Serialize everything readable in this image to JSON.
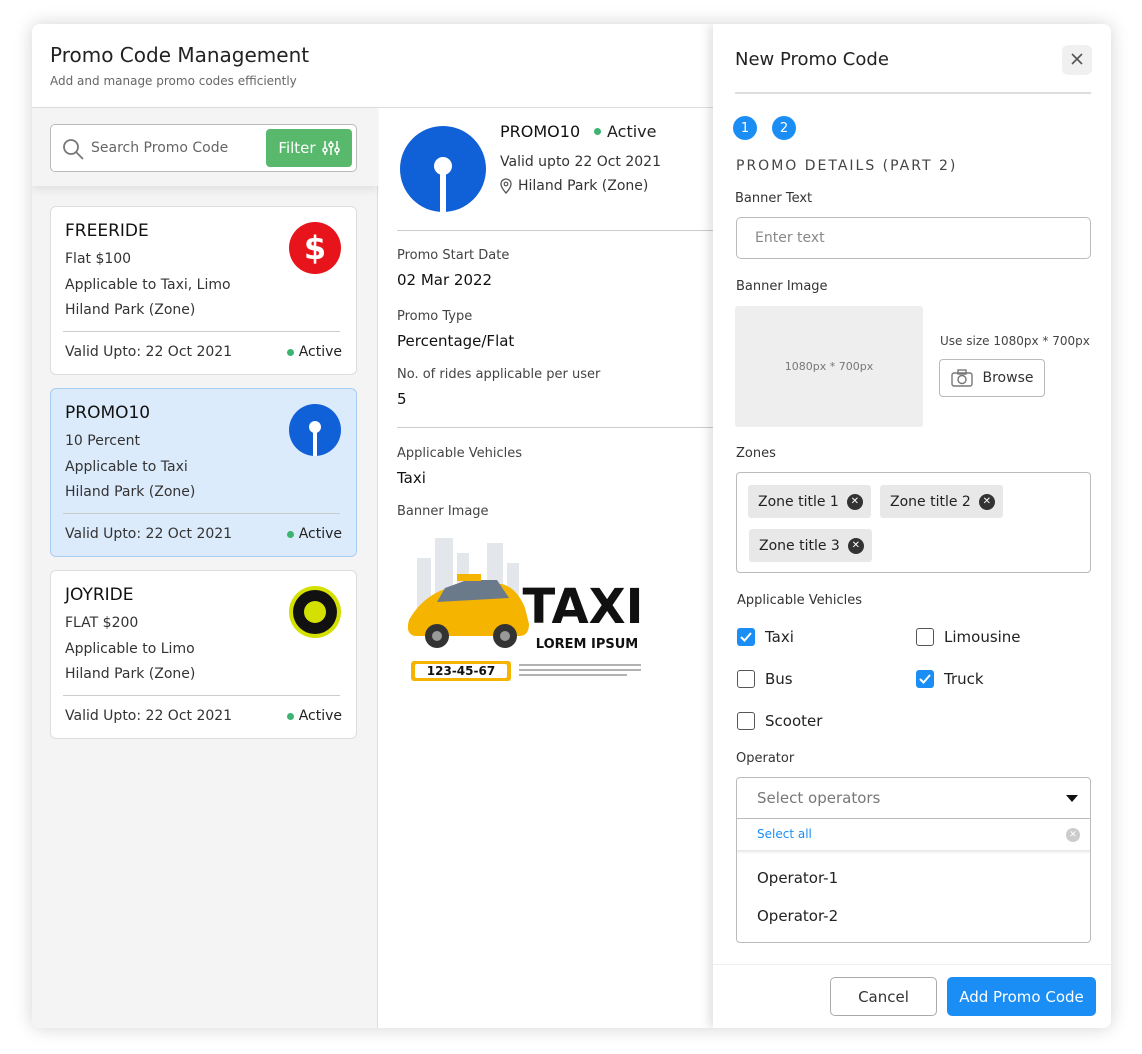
{
  "header": {
    "title": "Promo Code Management",
    "subtitle": "Add and manage promo codes efficiently"
  },
  "search": {
    "placeholder": "Search Promo Code",
    "filter_label": "Filter"
  },
  "promos": [
    {
      "code": "FREERIDE",
      "line1": "Flat $100",
      "line2": "Applicable to Taxi, Limo",
      "line3": "Hiland Park (Zone)",
      "valid": "Valid Upto: 22 Oct 2021",
      "status": "Active",
      "logo_icon": "dollar-coin-icon",
      "logo_color": "#e8141b"
    },
    {
      "code": "PROMO10",
      "line1": "10 Percent",
      "line2": "Applicable to Taxi",
      "line3": "Hiland Park (Zone)",
      "valid": "Valid Upto: 22 Oct 2021",
      "status": "Active",
      "logo_icon": "keyhole-logo-icon",
      "logo_color": "#1060d8"
    },
    {
      "code": "JOYRIDE",
      "line1": "FLAT $200",
      "line2": "Applicable to Limo",
      "line3": "Hiland Park (Zone)",
      "valid": "Valid Upto: 22 Oct 2021",
      "status": "Active",
      "logo_icon": "ring-logo-icon",
      "logo_color": "#d4e000"
    }
  ],
  "detail": {
    "code": "PROMO10",
    "status": "Active",
    "valid": "Valid upto 22 Oct 2021",
    "zone": "Hiland Park (Zone)",
    "start_date_label": "Promo Start Date",
    "start_date": "02 Mar 2022",
    "type_label": "Promo Type",
    "type": "Percentage/Flat",
    "rides_label": "No. of rides applicable per user",
    "rides": "5",
    "vehicles_label": "Applicable Vehicles",
    "vehicles": "Taxi",
    "banner_label": "Banner Image",
    "banner": {
      "headline": "TAXI",
      "tagline": "LOREM IPSUM",
      "phone": "123-45-67"
    }
  },
  "drawer": {
    "title": "New Promo Code",
    "steps": [
      "1",
      "2"
    ],
    "section": "PROMO DETAILS (PART 2)",
    "banner_text_label": "Banner Text",
    "banner_text_placeholder": "Enter text",
    "banner_image_label": "Banner Image",
    "image_placeholder": "1080px * 700px",
    "use_size": "Use size 1080px * 700px",
    "browse_label": "Browse",
    "zones_label": "Zones",
    "zones": [
      "Zone title 1",
      "Zone title 2",
      "Zone title 3"
    ],
    "vehicles_label": "Applicable Vehicles",
    "vehicles": [
      {
        "label": "Taxi",
        "checked": true
      },
      {
        "label": "Limousine",
        "checked": false
      },
      {
        "label": "Bus",
        "checked": false
      },
      {
        "label": "Truck",
        "checked": true
      },
      {
        "label": "Scooter",
        "checked": false
      }
    ],
    "operator_label": "Operator",
    "operator_placeholder": "Select operators",
    "select_all": "Select all",
    "operators": [
      "Operator-1",
      "Operator-2"
    ],
    "cancel_label": "Cancel",
    "add_label": "Add Promo Code"
  },
  "colors": {
    "accent": "#1a8ef5",
    "filter_green": "#58b86c",
    "active_dot": "#3cb371",
    "selected_card": "#dcebfb"
  }
}
